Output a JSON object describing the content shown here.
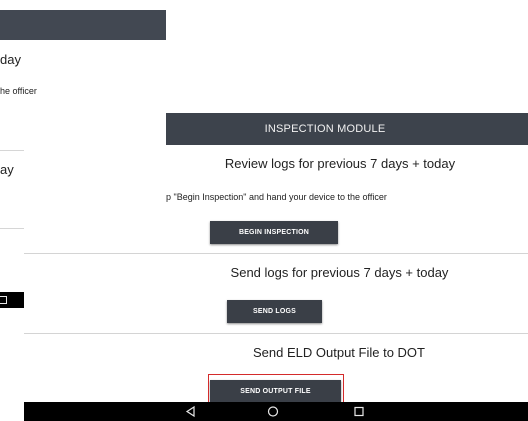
{
  "background_screen": {
    "line1": "day",
    "line2": "he officer",
    "line3": "ay"
  },
  "foreground_screen": {
    "header_title": "INSPECTION MODULE",
    "section_review": {
      "heading": "Review logs for previous 7 days + today",
      "instruction": "p \"Begin Inspection\" and hand your device to the officer",
      "button_label": "BEGIN INSPECTION"
    },
    "section_send_logs": {
      "heading": "Send logs for previous 7 days + today",
      "button_label": "SEND LOGS"
    },
    "section_output": {
      "heading": "Send ELD Output File to DOT",
      "button_label": "SEND OUTPUT FILE"
    }
  },
  "navbar_icons": [
    "back-icon",
    "home-icon",
    "recent-apps-icon"
  ],
  "colors": {
    "header_bg": "#3d434c",
    "button_bg": "#3a3f47",
    "highlight": "#d42b2b",
    "navbar_bg": "#000000"
  }
}
